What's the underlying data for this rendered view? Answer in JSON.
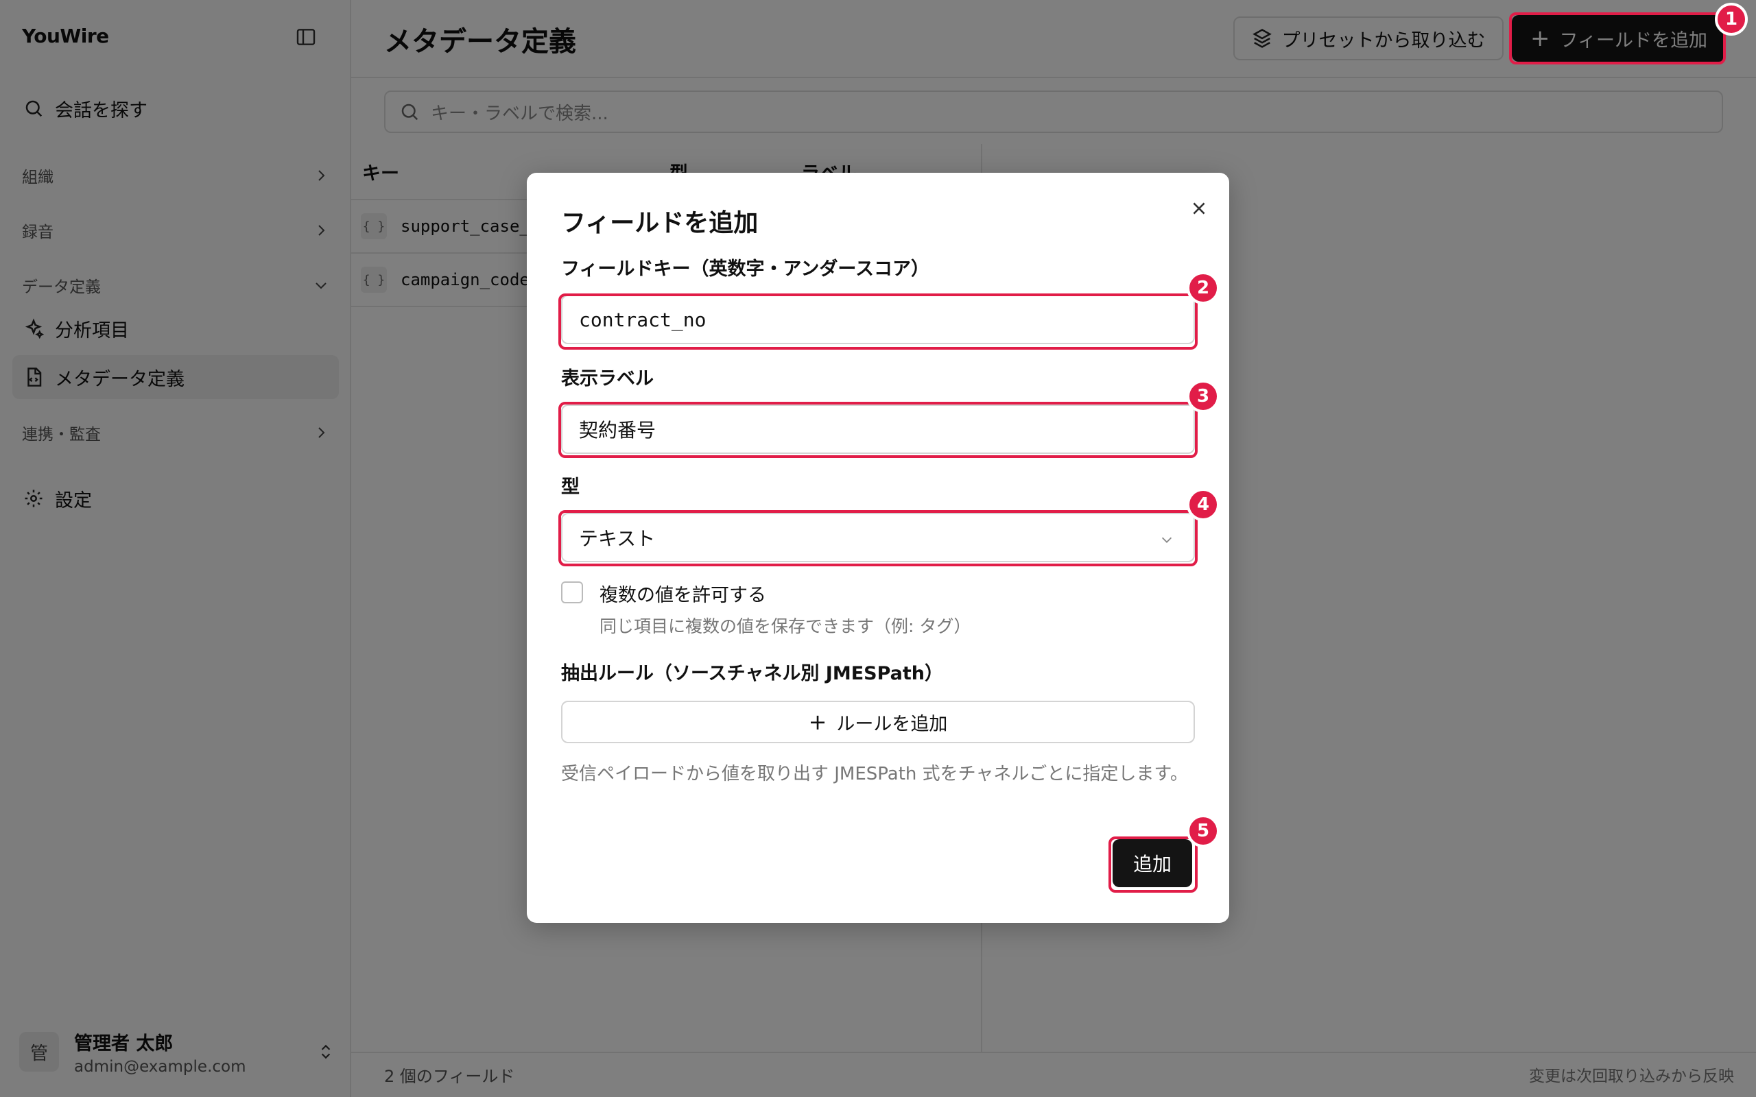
{
  "sidebar": {
    "brand": "YouWire",
    "search_label": "会話を探す",
    "groups": {
      "org": "組織",
      "recording": "録音",
      "data_def": "データ定義",
      "integration": "連携・監査"
    },
    "items": {
      "analysis": "分析項目",
      "metadata": "メタデータ定義",
      "settings": "設定"
    },
    "user": {
      "avatar": "管",
      "name": "管理者 太郎",
      "email": "admin@example.com"
    }
  },
  "header": {
    "title": "メタデータ定義",
    "preset_button": "プリセットから取り込む",
    "add_button": "フィールドを追加"
  },
  "search": {
    "placeholder": "キー・ラベルで検索..."
  },
  "table": {
    "columns": [
      "キー",
      "型",
      "ラベル"
    ],
    "rows": [
      {
        "icon": "{ }",
        "key": "support_case_"
      },
      {
        "icon": "{ }",
        "key": "campaign_code"
      }
    ]
  },
  "footer": {
    "count": "2 個のフィールド",
    "note": "変更は次回取り込みから反映"
  },
  "dialog": {
    "title": "フィールドを追加",
    "key_label": "フィールドキー（英数字・アンダースコア）",
    "key_value": "contract_no",
    "display_label": "表示ラベル",
    "display_value": "契約番号",
    "type_label": "型",
    "type_value": "テキスト",
    "multi_label": "複数の値を許可する",
    "multi_help": "同じ項目に複数の値を保存できます（例: タグ）",
    "multi_checked": false,
    "rules_label": "抽出ルール（ソースチャネル別 JMESPath）",
    "add_rule_button": "ルールを追加",
    "rules_help": "受信ペイロードから値を取り出す JMESPath 式をチャネルごとに指定します。",
    "submit": "追加"
  },
  "annotations": [
    "1",
    "2",
    "3",
    "4",
    "5"
  ],
  "colors": {
    "highlight": "#e11d48",
    "primary_button": "#141414"
  }
}
